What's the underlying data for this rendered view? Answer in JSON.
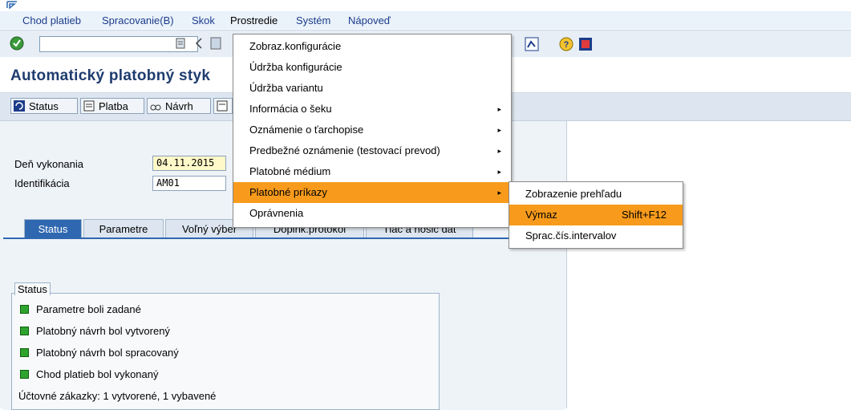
{
  "menubar": {
    "items": [
      {
        "label": "Chod platieb"
      },
      {
        "label": "Spracovanie(B)"
      },
      {
        "label": "Skok"
      },
      {
        "label": "Prostredie"
      },
      {
        "label": "Systém"
      },
      {
        "label": "Nápoveď"
      }
    ]
  },
  "title": "Automatický platobný styk",
  "app_toolbar": {
    "buttons": [
      {
        "label": "Status"
      },
      {
        "label": "Platba"
      },
      {
        "label": "Návrh"
      }
    ]
  },
  "fields": {
    "execution_date_label": "Deň vykonania",
    "execution_date_value": "04.11.2015",
    "identification_label": "Identifikácia",
    "identification_value": "AM01"
  },
  "tabs": [
    {
      "label": "Status"
    },
    {
      "label": "Parametre"
    },
    {
      "label": "Voľný výber"
    },
    {
      "label": "Doplňk.protokol"
    },
    {
      "label": "Tlač a nosič dát"
    }
  ],
  "status": {
    "title": "Status",
    "items": [
      "Parametre boli zadané",
      "Platobný návrh bol vytvorený",
      "Platobný návrh bol spracovaný",
      "Chod platieb bol vykonaný"
    ],
    "summary": "Účtovné zákazky: 1 vytvorené, 1 vybavené"
  },
  "prostredie_menu": {
    "items": [
      {
        "label": "Zobraz.konfigurácie",
        "submenu": false
      },
      {
        "label": "Údržba konfigurácie",
        "submenu": false
      },
      {
        "label": "Údržba variantu",
        "submenu": false
      },
      {
        "label": "Informácia o šeku",
        "submenu": true
      },
      {
        "label": "Oznámenie o ťarchopise",
        "submenu": true
      },
      {
        "label": "Predbežné oznámenie (testovací prevod)",
        "submenu": true
      },
      {
        "label": "Platobné médium",
        "submenu": true
      },
      {
        "label": "Platobné príkazy",
        "submenu": true,
        "highlighted": true
      },
      {
        "label": "Oprávnenia",
        "submenu": false
      }
    ]
  },
  "platobne_prikazy_submenu": {
    "items": [
      {
        "label": "Zobrazenie prehľadu",
        "shortcut": ""
      },
      {
        "label": "Výmaz",
        "shortcut": "Shift+F12",
        "highlighted": true
      },
      {
        "label": "Sprac.čís.intervalov",
        "shortcut": ""
      }
    ]
  },
  "colors": {
    "highlight": "#f89b1c",
    "title": "#1e3c6e",
    "active_tab": "#2f68b0",
    "status_led": "#2ea32e"
  }
}
